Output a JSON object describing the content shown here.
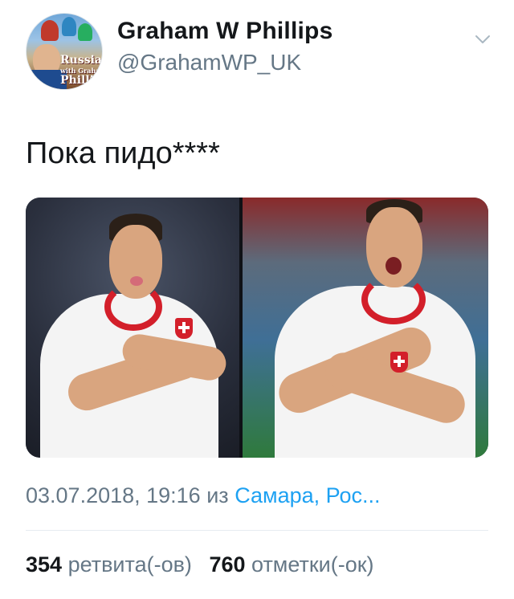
{
  "author": {
    "name": "Graham W Phillips",
    "handle": "@GrahamWP_UK",
    "avatar_text": "Russia with Graham Phillips"
  },
  "menu_icon": "chevron-down-icon",
  "tweet": {
    "text": "Пока пидо****"
  },
  "meta": {
    "datetime": "03.07.2018, 19:16",
    "via_word": "из",
    "location": "Самара, Рос..."
  },
  "stats": {
    "retweets_count": "354",
    "retweets_label": "ретвита(-ов)",
    "likes_count": "760",
    "likes_label": "отметки(-ок)"
  },
  "colors": {
    "text": "#14171a",
    "secondary": "#657786",
    "link": "#1da1f2",
    "separator": "#e6ecf0"
  }
}
